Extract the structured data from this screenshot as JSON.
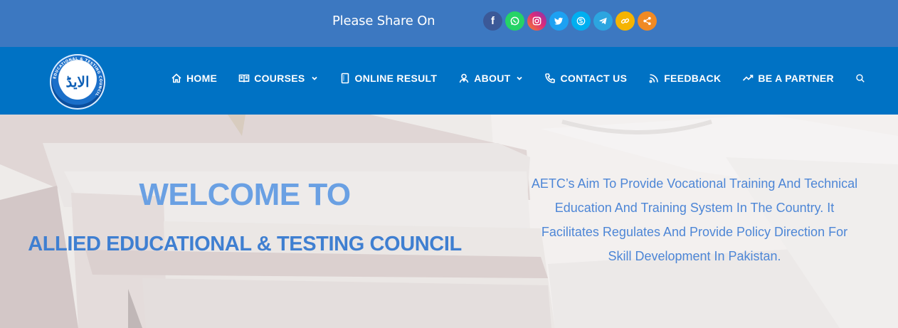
{
  "share_bar": {
    "label": "Please Share On",
    "icons": [
      {
        "name": "facebook-icon",
        "glyph": "f",
        "color": "#3b5998"
      },
      {
        "name": "whatsapp-icon",
        "glyph": "",
        "color": "#25d366"
      },
      {
        "name": "instagram-icon",
        "glyph": "",
        "color": "#d6249f"
      },
      {
        "name": "twitter-icon",
        "glyph": "",
        "color": "#1da1f2"
      },
      {
        "name": "skype-icon",
        "glyph": "",
        "color": "#00aff0"
      },
      {
        "name": "telegram-icon",
        "glyph": "",
        "color": "#2ca5e0"
      },
      {
        "name": "copy-link-icon",
        "glyph": "",
        "color": "#f5b400"
      },
      {
        "name": "share-icon",
        "glyph": "",
        "color": "#f08a24"
      }
    ]
  },
  "nav": {
    "logo_text": "الایڈ",
    "logo_ring_text": "EDUCATIONAL & TESTING COUNCIL",
    "items": [
      {
        "label": "HOME",
        "icon": "home-icon"
      },
      {
        "label": "COURSES",
        "icon": "book-icon",
        "dropdown": true
      },
      {
        "label": "ONLINE RESULT",
        "icon": "document-icon"
      },
      {
        "label": "ABOUT",
        "icon": "user-group-icon",
        "dropdown": true
      },
      {
        "label": "CONTACT US",
        "icon": "phone-icon"
      },
      {
        "label": "FEEDBACK",
        "icon": "rss-icon"
      },
      {
        "label": "BE A PARTNER",
        "icon": "trend-icon"
      }
    ],
    "search_icon": "search-icon"
  },
  "hero": {
    "welcome": "WELCOME TO",
    "council": "ALLIED EDUCATIONAL & TESTING COUNCIL",
    "aim_lines": [
      "AETC’s Aim To Provide Vocational Training And Technical",
      "Education And Training System In The Country. It",
      "Facilitates Regulates And Provide Policy Direction For",
      "Skill Development In Pakistan."
    ]
  },
  "colors": {
    "share_bar_bg": "#3c78c1",
    "nav_bg": "#0072c4",
    "welcome_text": "#6aa0e3",
    "council_text": "#3f7fd1",
    "aim_text": "#4d86d6"
  }
}
